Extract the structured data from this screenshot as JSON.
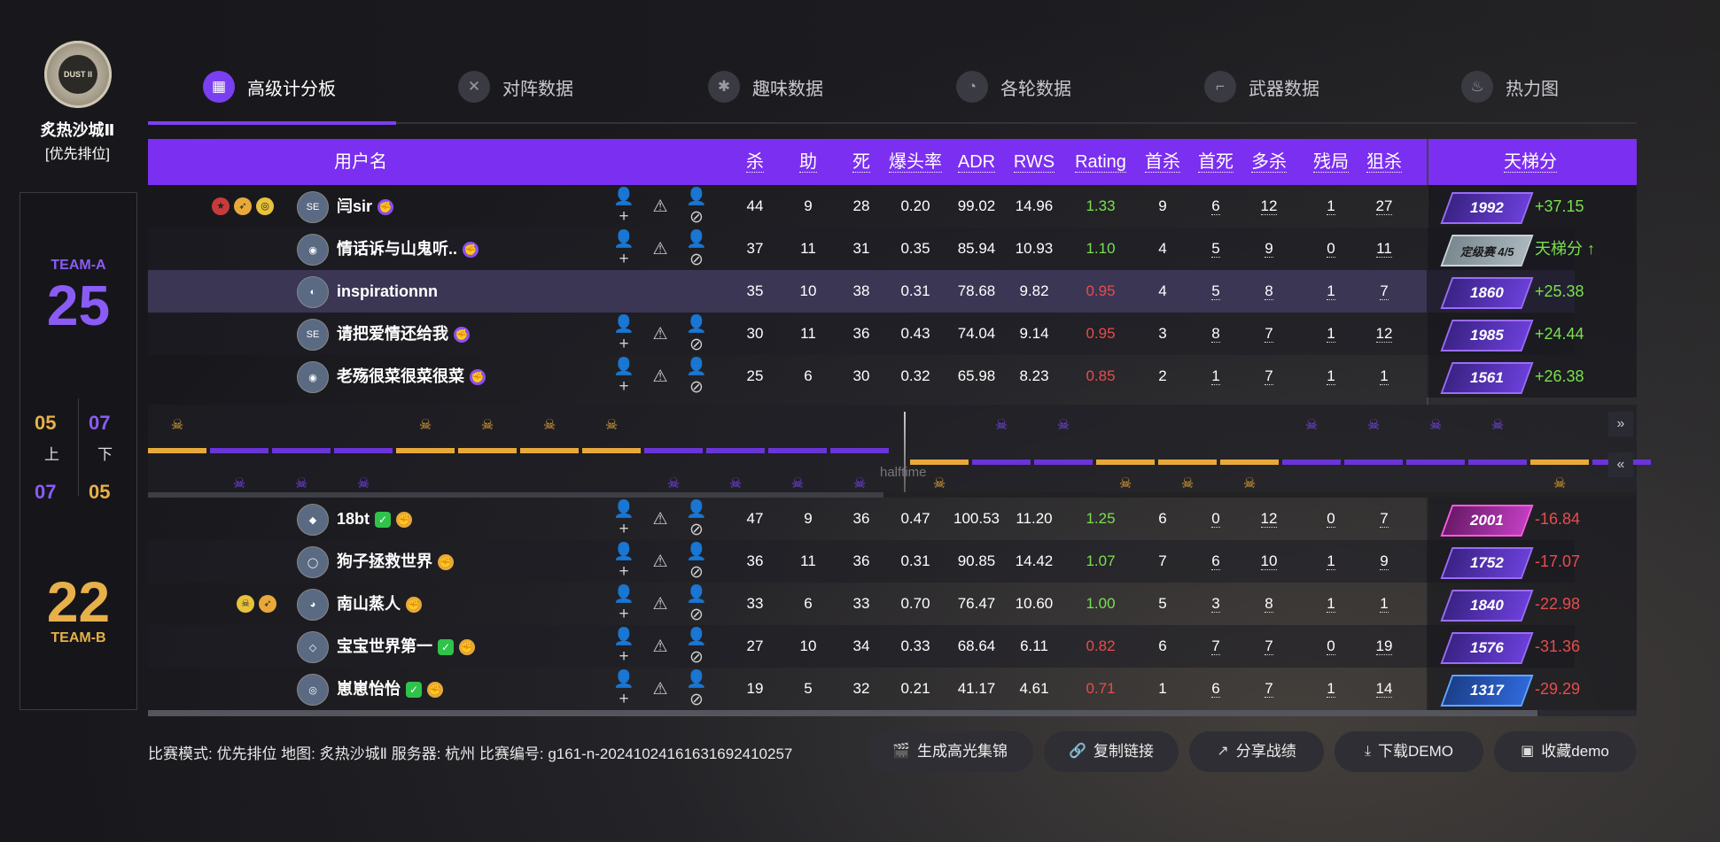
{
  "map": {
    "name": "炙热沙城Ⅱ",
    "mode": "[优先排位]",
    "logo_text": "DUST II"
  },
  "teams": {
    "a": {
      "label": "TEAM-A",
      "score": "25",
      "first_half": "05",
      "second_half": "07"
    },
    "b": {
      "label": "TEAM-B",
      "score": "22",
      "first_half": "07",
      "second_half": "05"
    },
    "half_labels": {
      "first": "上",
      "second": "下"
    }
  },
  "tabs": [
    {
      "label": "高级计分板",
      "icon": "scoreboard-icon",
      "active": true
    },
    {
      "label": "对阵数据",
      "icon": "versus-icon",
      "active": false
    },
    {
      "label": "趣味数据",
      "icon": "fun-icon",
      "active": false
    },
    {
      "label": "各轮数据",
      "icon": "rounds-icon",
      "active": false
    },
    {
      "label": "武器数据",
      "icon": "weapon-icon",
      "active": false
    },
    {
      "label": "热力图",
      "icon": "heatmap-icon",
      "active": false
    }
  ],
  "columns": {
    "username": "用户名",
    "kills": "杀",
    "assists": "助",
    "deaths": "死",
    "hs": "爆头率",
    "adr": "ADR",
    "rws": "RWS",
    "rating": "Rating",
    "fk": "首杀",
    "fd": "首死",
    "multi": "多杀",
    "clutch": "残局",
    "sniper": "狙杀",
    "ladder": "天梯分"
  },
  "team_a_players": [
    {
      "name": "闫sir",
      "avatar_label": "SE",
      "kills": "44",
      "assists": "9",
      "deaths": "28",
      "hs": "0.20",
      "adr": "99.02",
      "rws": "14.96",
      "rating": "1.33",
      "rating_color": "#7be04f",
      "fk": "9",
      "fd": "6",
      "multi": "12",
      "clutch": "1",
      "sniper": "27",
      "ladder": "1992",
      "ladder_style": "purple",
      "delta": "+37.15",
      "delta_dir": "up",
      "has_actions": true,
      "badge": "prime-purple"
    },
    {
      "name": "情话诉与山鬼听..",
      "avatar_label": "◉",
      "kills": "37",
      "assists": "11",
      "deaths": "31",
      "hs": "0.35",
      "adr": "85.94",
      "rws": "10.93",
      "rating": "1.10",
      "rating_color": "#7be04f",
      "fk": "4",
      "fd": "5",
      "multi": "9",
      "clutch": "0",
      "sniper": "11",
      "ladder": "定级赛 4/5",
      "ladder_style": "grey",
      "delta": "天梯分 ↑",
      "delta_dir": "up",
      "has_actions": true,
      "badge": "prime-purple"
    },
    {
      "name": "inspirationnn",
      "avatar_label": "◐",
      "kills": "35",
      "assists": "10",
      "deaths": "38",
      "hs": "0.31",
      "adr": "78.68",
      "rws": "9.82",
      "rating": "0.95",
      "rating_color": "#e84c4c",
      "fk": "4",
      "fd": "5",
      "multi": "8",
      "clutch": "1",
      "sniper": "7",
      "ladder": "1860",
      "ladder_style": "purple",
      "delta": "+25.38",
      "delta_dir": "up",
      "has_actions": false,
      "badge": ""
    },
    {
      "name": "请把爱情还给我",
      "avatar_label": "SE",
      "kills": "30",
      "assists": "11",
      "deaths": "36",
      "hs": "0.43",
      "adr": "74.04",
      "rws": "9.14",
      "rating": "0.95",
      "rating_color": "#e84c4c",
      "fk": "3",
      "fd": "8",
      "multi": "7",
      "clutch": "1",
      "sniper": "12",
      "ladder": "1985",
      "ladder_style": "purple",
      "delta": "+24.44",
      "delta_dir": "up",
      "has_actions": true,
      "badge": "prime-purple"
    },
    {
      "name": "老殇很菜很菜很菜",
      "avatar_label": "◉",
      "kills": "25",
      "assists": "6",
      "deaths": "30",
      "hs": "0.32",
      "adr": "65.98",
      "rws": "8.23",
      "rating": "0.85",
      "rating_color": "#e84c4c",
      "fk": "2",
      "fd": "1",
      "multi": "7",
      "clutch": "1",
      "sniper": "1",
      "ladder": "1561",
      "ladder_style": "purple",
      "delta": "+26.38",
      "delta_dir": "up",
      "has_actions": true,
      "badge": "prime-purple"
    }
  ],
  "team_b_players": [
    {
      "name": "18bt",
      "avatar_label": "◆",
      "kills": "47",
      "assists": "9",
      "deaths": "36",
      "hs": "0.47",
      "adr": "100.53",
      "rws": "11.20",
      "rating": "1.25",
      "rating_color": "#7be04f",
      "fk": "6",
      "fd": "0",
      "multi": "12",
      "clutch": "0",
      "sniper": "7",
      "ladder": "2001",
      "ladder_style": "pink",
      "delta": "-16.84",
      "delta_dir": "down",
      "shield": true
    },
    {
      "name": "狗子拯救世界",
      "avatar_label": "◯",
      "kills": "36",
      "assists": "11",
      "deaths": "36",
      "hs": "0.31",
      "adr": "90.85",
      "rws": "14.42",
      "rating": "1.07",
      "rating_color": "#7be04f",
      "fk": "7",
      "fd": "6",
      "multi": "10",
      "clutch": "1",
      "sniper": "9",
      "ladder": "1752",
      "ladder_style": "purple",
      "delta": "-17.07",
      "delta_dir": "down",
      "shield": false
    },
    {
      "name": "南山蒸人",
      "avatar_label": "◕",
      "kills": "33",
      "assists": "6",
      "deaths": "33",
      "hs": "0.70",
      "adr": "76.47",
      "rws": "10.60",
      "rating": "1.00",
      "rating_color": "#7be04f",
      "fk": "5",
      "fd": "3",
      "multi": "8",
      "clutch": "1",
      "sniper": "1",
      "ladder": "1840",
      "ladder_style": "purple",
      "delta": "-22.98",
      "delta_dir": "down",
      "shield": false
    },
    {
      "name": "宝宝世界第一",
      "avatar_label": "◇",
      "kills": "27",
      "assists": "10",
      "deaths": "34",
      "hs": "0.33",
      "adr": "68.64",
      "rws": "6.11",
      "rating": "0.82",
      "rating_color": "#e84c4c",
      "fk": "6",
      "fd": "7",
      "multi": "7",
      "clutch": "0",
      "sniper": "19",
      "ladder": "1576",
      "ladder_style": "purple",
      "delta": "-31.36",
      "delta_dir": "down",
      "shield": true
    },
    {
      "name": "崽崽怡怡",
      "avatar_label": "◎",
      "kills": "19",
      "assists": "5",
      "deaths": "32",
      "hs": "0.21",
      "adr": "41.17",
      "rws": "4.61",
      "rating": "0.71",
      "rating_color": "#e84c4c",
      "fk": "1",
      "fd": "6",
      "multi": "7",
      "clutch": "1",
      "sniper": "14",
      "ladder": "1317",
      "ladder_style": "blue",
      "delta": "-29.29",
      "delta_dir": "down",
      "shield": true
    }
  ],
  "action_icons": {
    "add_friend": "add-friend-icon",
    "report": "report-icon",
    "block": "block-user-icon"
  },
  "timeline": {
    "halftime_label": "halftime"
  },
  "footer": {
    "info": "比赛模式: 优先排位 地图: 炙热沙城Ⅱ 服务器: 杭州 比赛编号: g161-n-2024102416163169241025​7",
    "buttons": [
      {
        "label": "生成高光集锦",
        "icon": "clapper-icon"
      },
      {
        "label": "复制链接",
        "icon": "link-icon"
      },
      {
        "label": "分享战绩",
        "icon": "share-icon"
      },
      {
        "label": "下载DEMO",
        "icon": "download-icon"
      },
      {
        "label": "收藏demo",
        "icon": "bookmark-icon"
      }
    ]
  },
  "colors": {
    "accent": "#7b2ff0",
    "gold": "#e8a93a",
    "positive": "#7be04f",
    "negative": "#e84c4c"
  }
}
